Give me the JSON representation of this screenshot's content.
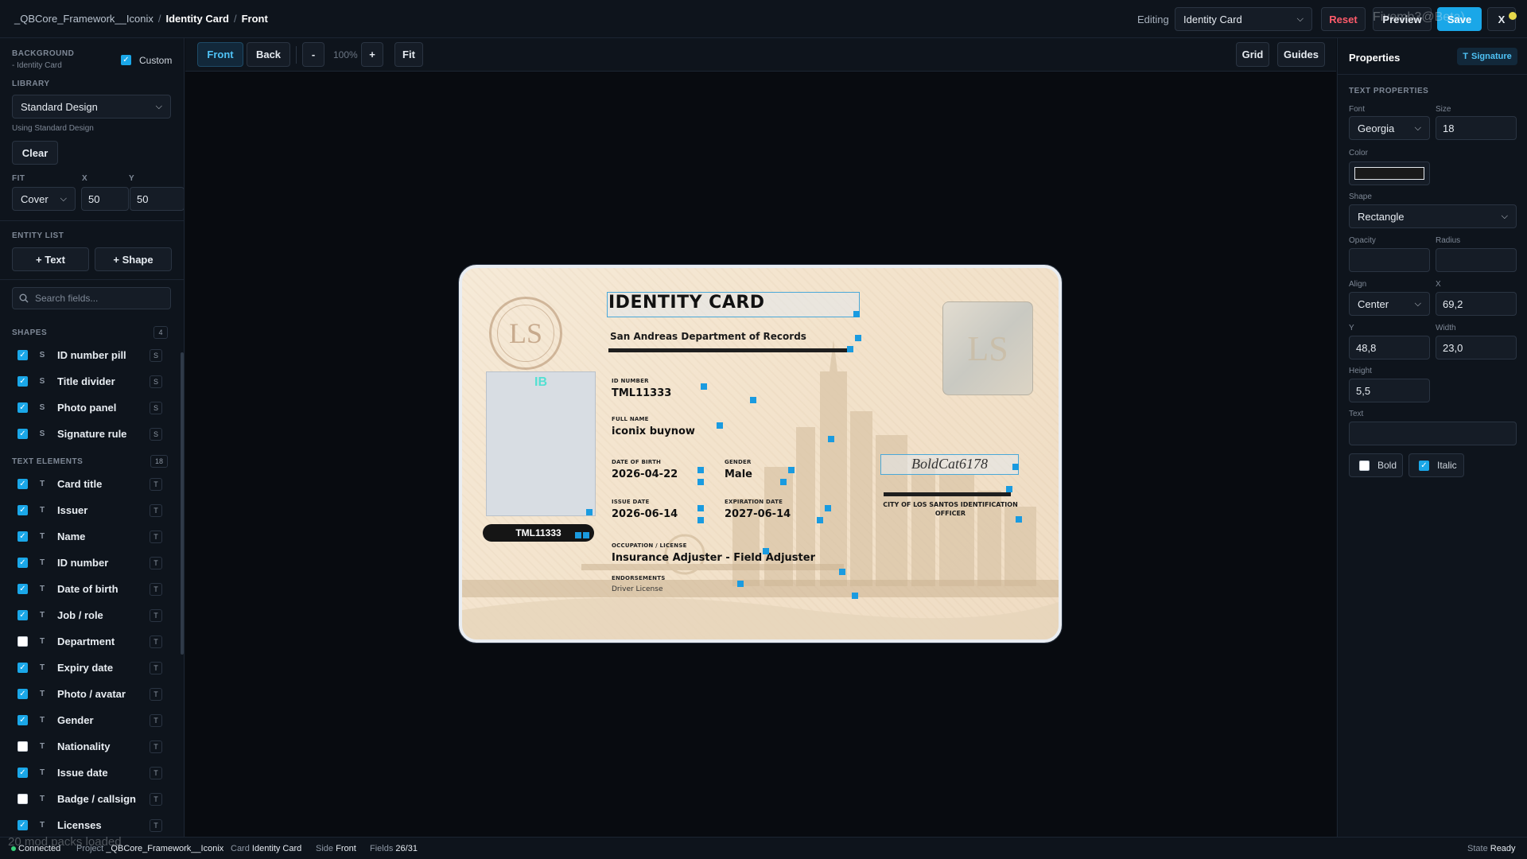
{
  "topbar": {
    "crumbs": [
      "_QBCore_Framework__Iconix",
      "Identity Card",
      "Front"
    ],
    "editing_label": "Editing",
    "editing_value": "Identity Card",
    "reset_label": "Reset",
    "preview_label": "Preview",
    "save_label": "Save",
    "close_label": "X",
    "ghost_text": "Fivemb3@Beta)"
  },
  "left": {
    "background_label": "BACKGROUND",
    "background_sub": "- Identity Card",
    "custom_label": "Custom",
    "library_label": "LIBRARY",
    "library_value": "Standard Design",
    "using_label": "Using Standard Design",
    "clear_label": "Clear",
    "fit_label": "FIT",
    "x_label": "X",
    "y_label": "Y",
    "fit_value": "Cover",
    "x_value": "50",
    "y_value": "50",
    "entity_list_label": "ENTITY LIST",
    "add_text_label": "+ Text",
    "add_shape_label": "+ Shape",
    "search_placeholder": "Search fields...",
    "shapes_label": "SHAPES",
    "shapes_count": "4",
    "shapes": [
      {
        "label": "ID number pill",
        "checked": true,
        "tag": "S"
      },
      {
        "label": "Title divider",
        "checked": true,
        "tag": "S"
      },
      {
        "label": "Photo panel",
        "checked": true,
        "tag": "S"
      },
      {
        "label": "Signature rule",
        "checked": true,
        "tag": "S"
      }
    ],
    "text_label": "TEXT ELEMENTS",
    "text_count": "18",
    "texts": [
      {
        "label": "Card title",
        "checked": true,
        "tag": "T"
      },
      {
        "label": "Issuer",
        "checked": true,
        "tag": "T"
      },
      {
        "label": "Name",
        "checked": true,
        "tag": "T"
      },
      {
        "label": "ID number",
        "checked": true,
        "tag": "T"
      },
      {
        "label": "Date of birth",
        "checked": true,
        "tag": "T"
      },
      {
        "label": "Job / role",
        "checked": true,
        "tag": "T"
      },
      {
        "label": "Department",
        "checked": false,
        "tag": "T"
      },
      {
        "label": "Expiry date",
        "checked": true,
        "tag": "T"
      },
      {
        "label": "Photo / avatar",
        "checked": true,
        "tag": "T"
      },
      {
        "label": "Gender",
        "checked": true,
        "tag": "T"
      },
      {
        "label": "Nationality",
        "checked": false,
        "tag": "T"
      },
      {
        "label": "Issue date",
        "checked": true,
        "tag": "T"
      },
      {
        "label": "Badge / callsign",
        "checked": false,
        "tag": "T"
      },
      {
        "label": "Licenses",
        "checked": true,
        "tag": "T"
      }
    ]
  },
  "toolbar": {
    "front_label": "Front",
    "back_label": "Back",
    "zoom_out_label": "-",
    "zoom_value": "100%",
    "zoom_in_label": "+",
    "fit_label": "Fit",
    "grid_label": "Grid",
    "guides_label": "Guides"
  },
  "card": {
    "title": "IDENTITY CARD",
    "issuer": "San Andreas Department of Records",
    "seal_text": "LS",
    "photo_initials": "IB",
    "pill_text": "TML11333",
    "id_number_label": "ID NUMBER",
    "id_number": "TML11333",
    "full_name_label": "FULL NAME",
    "full_name": "iconix buynow",
    "dob_label": "DATE OF BIRTH",
    "dob": "2026-04-22",
    "gender_label": "GENDER",
    "gender": "Male",
    "issue_label": "ISSUE DATE",
    "issue": "2026-06-14",
    "expiry_label": "EXPIRATION DATE",
    "expiry": "2027-06-14",
    "occupation_label": "OCCUPATION / LICENSE",
    "occupation": "Insurance Adjuster - Field Adjuster",
    "endorsements_label": "ENDORSEMENTS",
    "endorsements": "Driver License",
    "signature": "BoldCat6178",
    "sig_caption": "CITY OF LOS SANTOS IDENTIFICATION OFFICER"
  },
  "right": {
    "title": "Properties",
    "badge_icon": "T",
    "badge_label": "Signature",
    "section_label": "TEXT PROPERTIES",
    "font_label": "Font",
    "font_value": "Georgia",
    "size_label": "Size",
    "size_value": "18",
    "color_label": "Color",
    "color_value": "#1a1a1a",
    "shape_label": "Shape",
    "shape_value": "Rectangle",
    "opacity_label": "Opacity",
    "radius_label": "Radius",
    "align_label": "Align",
    "align_value": "Center",
    "x_label": "X",
    "x_value": "69,2",
    "y_label": "Y",
    "y_value": "48,8",
    "width_label": "Width",
    "width_value": "23,0",
    "height_label": "Height",
    "height_value": "5,5",
    "text_label": "Text",
    "bold_label": "Bold",
    "italic_label": "Italic"
  },
  "status": {
    "connected": "Connected",
    "project_label": "Project",
    "project_value": "_QBCore_Framework__Iconix",
    "card_label": "Card",
    "card_value": "Identity Card",
    "side_label": "Side",
    "side_value": "Front",
    "fields_label": "Fields",
    "fields_value": "26/31",
    "state_label": "State",
    "state_value": "Ready",
    "toast": "20 mod packs loaded"
  }
}
